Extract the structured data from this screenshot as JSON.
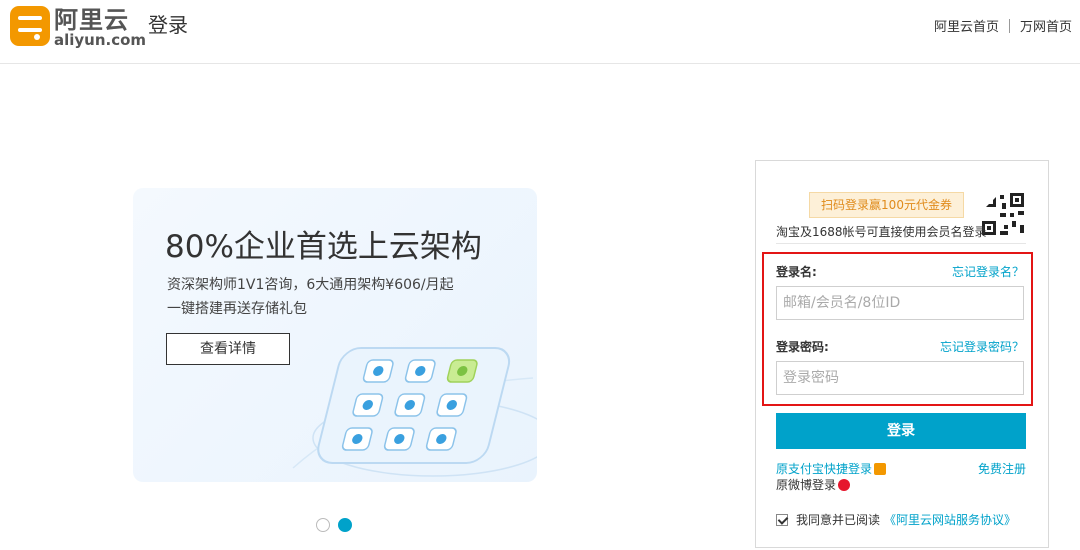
{
  "header": {
    "logo_cn": "阿里云",
    "logo_en": "aliyun.com",
    "page_title": "登录",
    "links": [
      "阿里云首页",
      "万网首页"
    ]
  },
  "banner": {
    "title": "80%企业首选上云架构",
    "subtitle_1": "资深架构师1V1咨询，6大通用架构¥606/月起",
    "subtitle_2": "一键搭建再送存储礼包",
    "cta": "查看详情"
  },
  "carousel": {
    "count": 2,
    "active_index": 1
  },
  "login": {
    "promo": "扫码登录赢100元代金券",
    "qr_note": "淘宝及1688帐号可直接使用会员名登录",
    "username_label": "登录名:",
    "forgot_username": "忘记登录名？",
    "username_placeholder": "邮箱/会员名/8位ID",
    "password_label": "登录密码:",
    "forgot_password": "忘记登录密码？",
    "password_placeholder": "登录密码",
    "submit": "登录",
    "alipay_login": "原支付宝快捷登录",
    "weibo_login": "原微博登录",
    "register": "免费注册",
    "agree_prefix": "我同意并已阅读",
    "agreement": "《阿里云网站服务协议》"
  },
  "colors": {
    "accent": "#00a2ca",
    "brand": "#f39800",
    "highlight": "#e31515"
  }
}
